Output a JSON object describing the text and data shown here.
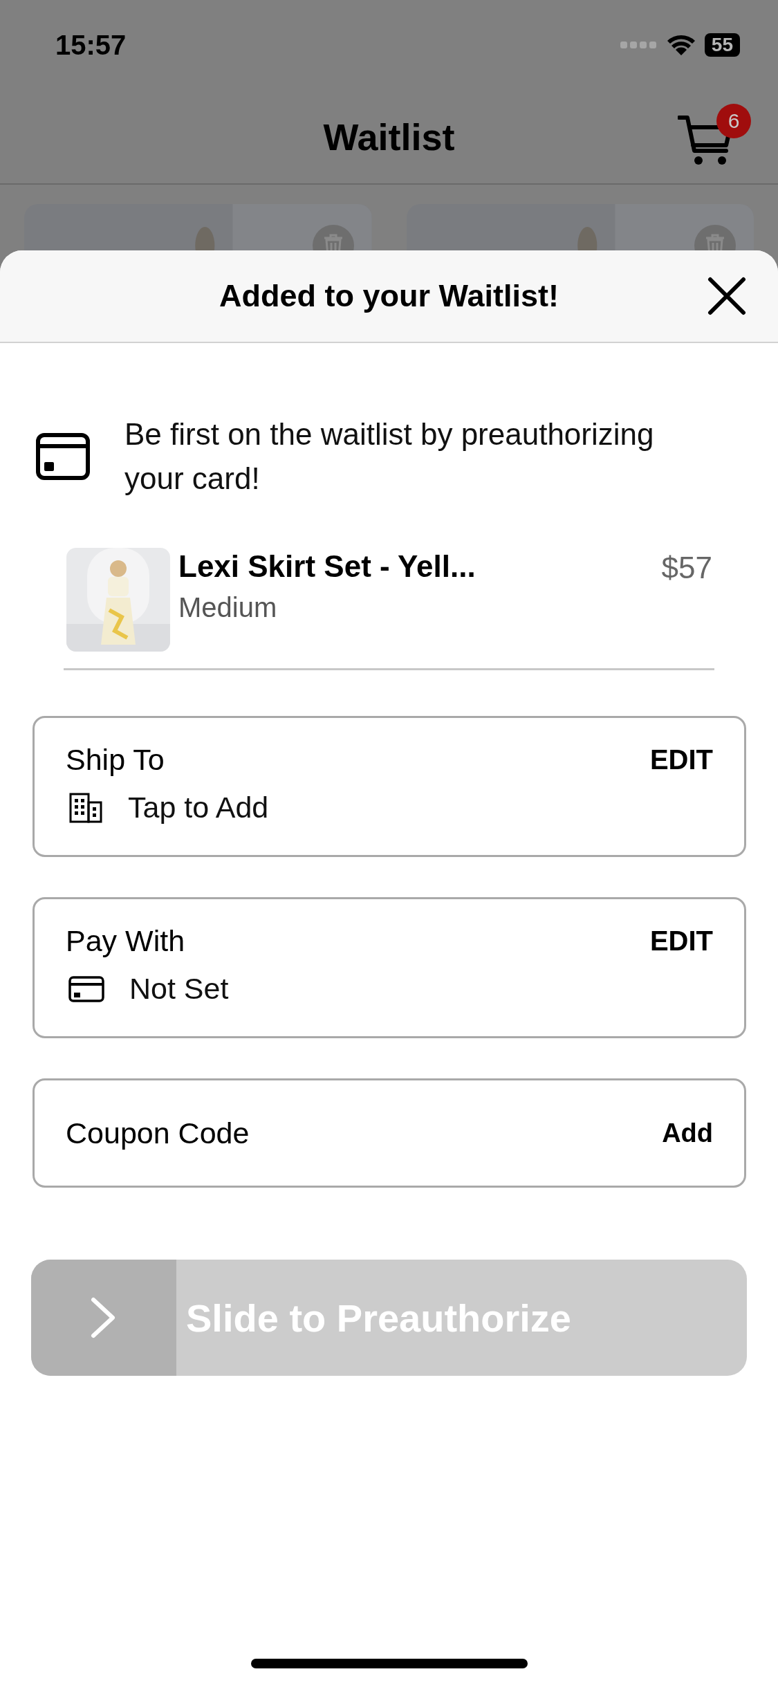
{
  "status_bar": {
    "time": "15:57",
    "battery": "55"
  },
  "header": {
    "title": "Waitlist",
    "cart_count": "6"
  },
  "sheet": {
    "title": "Added to your Waitlist!",
    "message": "Be first on the waitlist by preauthorizing your card!",
    "product": {
      "name": "Lexi Skirt Set - Yell...",
      "variant": "Medium",
      "price": "$57"
    },
    "sections": [
      {
        "kind": "address",
        "label": "Ship To",
        "action": "EDIT",
        "value": "Tap to Add"
      },
      {
        "kind": "payment",
        "label": "Pay With",
        "action": "EDIT",
        "value": "Not Set"
      },
      {
        "kind": "coupon",
        "label": "Coupon Code",
        "action": "Add"
      }
    ],
    "slider": {
      "label": "Slide to Preauthorize",
      "disabled": true
    }
  }
}
